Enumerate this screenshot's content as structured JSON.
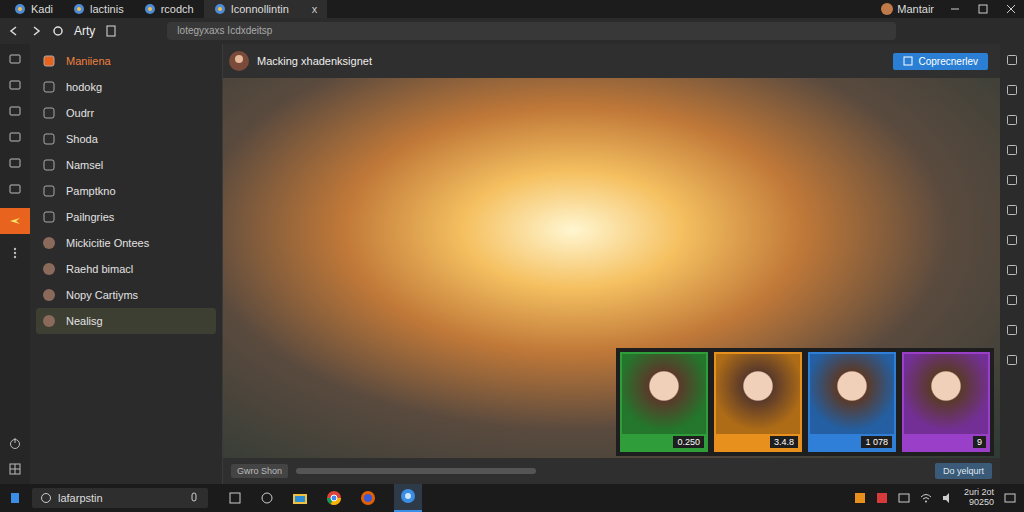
{
  "window": {
    "profile": "Mantair"
  },
  "tabs": [
    {
      "label": "Kadi",
      "selected": false,
      "closable": false
    },
    {
      "label": "lactinis",
      "selected": false,
      "closable": false
    },
    {
      "label": "rcodch",
      "selected": false,
      "closable": false
    },
    {
      "label": "Iconnollintin",
      "selected": true,
      "closable": true
    }
  ],
  "tab_close": "x",
  "toolbar": {
    "title": "Arty",
    "address": "lotegyxaxs Icdxdeitsp"
  },
  "sidebar": {
    "items": [
      {
        "label": "Maniiena",
        "selected": false,
        "accent": true
      },
      {
        "label": "hodokg",
        "selected": false,
        "accent": false
      },
      {
        "label": "Oudrr",
        "selected": false,
        "accent": false
      },
      {
        "label": "Shoda",
        "selected": false,
        "accent": false
      },
      {
        "label": "Namsel",
        "selected": false,
        "accent": false
      },
      {
        "label": "Pamptkno",
        "selected": false,
        "accent": false
      },
      {
        "label": "Pailngries",
        "selected": false,
        "accent": false
      },
      {
        "label": "Mickicitie Ontees",
        "selected": false,
        "accent": false
      },
      {
        "label": "Raehd bimacl",
        "selected": false,
        "accent": false
      },
      {
        "label": "Nopy Cartiyms",
        "selected": false,
        "accent": false
      },
      {
        "label": "Nealisg",
        "selected": true,
        "accent": false
      }
    ]
  },
  "content": {
    "title": "Macking xhadenksignet",
    "action": "Coprecnerlev",
    "footer_left": "Gwro Shon",
    "footer_right": "Do yelqurt",
    "cards": [
      {
        "value": "0.250",
        "color": "#2f9e3a"
      },
      {
        "value": "3.4.8",
        "color": "#e8901e"
      },
      {
        "value": "1 078",
        "color": "#2f7fd8"
      },
      {
        "value": "9",
        "color": "#9a3fc8"
      }
    ]
  },
  "taskbar": {
    "search": "lafarpstin",
    "time": "2uri 2ot",
    "date": "90250"
  }
}
